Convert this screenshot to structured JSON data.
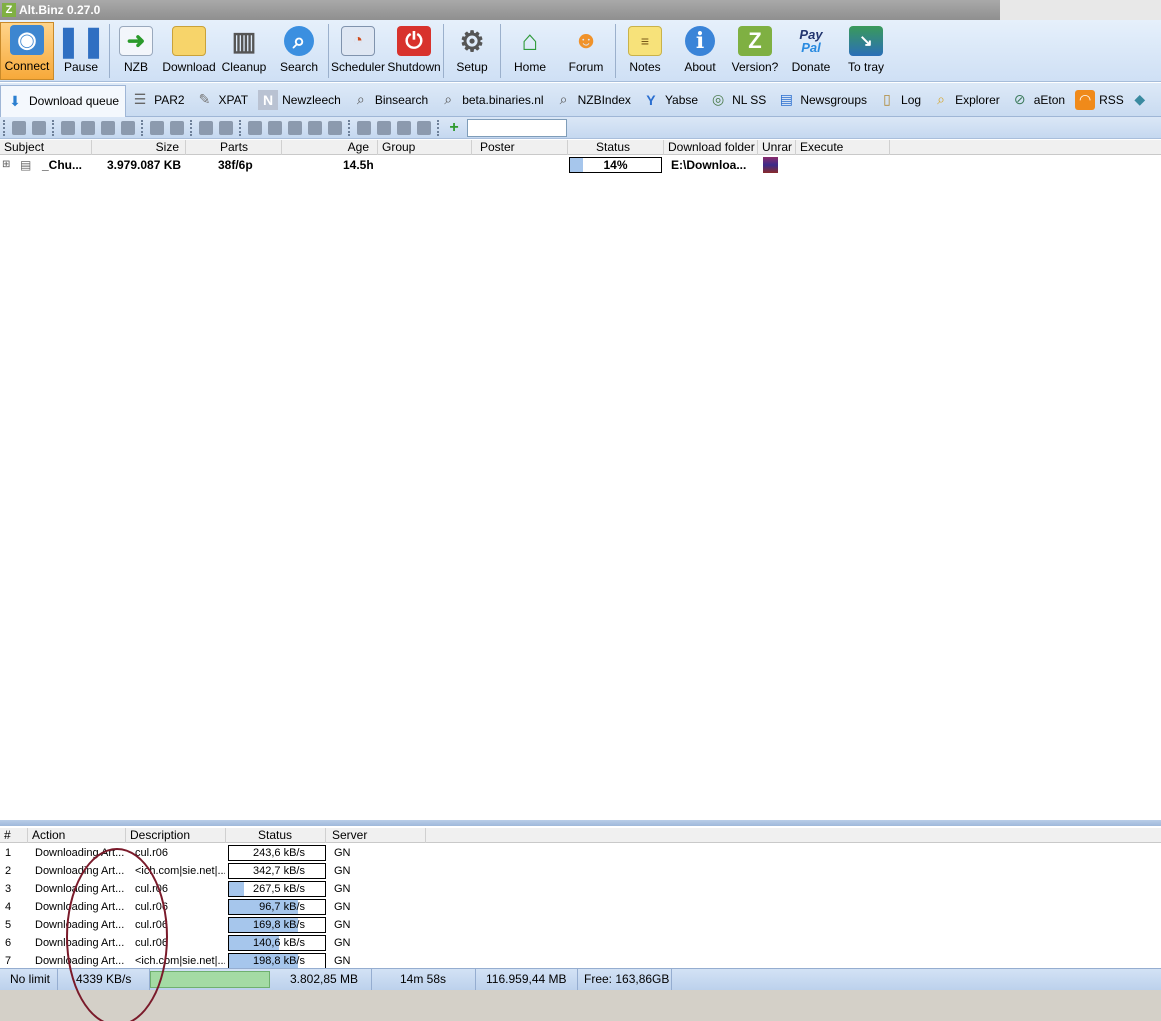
{
  "window": {
    "title": "Alt.Binz 0.27.0"
  },
  "toolbar": [
    {
      "label": "Connect",
      "icon": "connect-icon"
    },
    {
      "label": "Pause",
      "icon": "pause-icon"
    },
    {
      "label": "NZB",
      "icon": "nzb-icon"
    },
    {
      "label": "Download",
      "icon": "folder-icon"
    },
    {
      "label": "Cleanup",
      "icon": "trash-icon"
    },
    {
      "label": "Search",
      "icon": "search-icon"
    },
    {
      "label": "Scheduler",
      "icon": "calendar-clock-icon"
    },
    {
      "label": "Shutdown",
      "icon": "power-icon"
    },
    {
      "label": "Setup",
      "icon": "gear-icon"
    },
    {
      "label": "Home",
      "icon": "home-icon"
    },
    {
      "label": "Forum",
      "icon": "people-icon"
    },
    {
      "label": "Notes",
      "icon": "notes-icon"
    },
    {
      "label": "About",
      "icon": "info-icon"
    },
    {
      "label": "Version?",
      "icon": "version-icon"
    },
    {
      "label": "Donate",
      "icon": "paypal-icon"
    },
    {
      "label": "To tray",
      "icon": "tray-icon"
    }
  ],
  "donate_icon": {
    "line1": "Pay",
    "line2": "Pal"
  },
  "version_icon_letter": "Z",
  "tabs": [
    "Download queue",
    "PAR2",
    "XPAT",
    "Newzleech",
    "Binsearch",
    "beta.binaries.nl",
    "NZBIndex",
    "Yabse",
    "NL SS",
    "Newsgroups",
    "Log",
    "Explorer",
    "aEton",
    "RSS"
  ],
  "queue": {
    "columns": [
      "Subject",
      "Size",
      "Parts",
      "Age",
      "Group",
      "Poster",
      "Status",
      "Download folder",
      "Unrar",
      "Execute"
    ],
    "rows": [
      {
        "subject": "_Chu...",
        "size": "3.979.087 KB",
        "parts": "38f/6p",
        "age": "14.5h",
        "group": "",
        "poster": "",
        "status": "14%",
        "progress": 0.14,
        "folder": "E:\\Downloa..."
      }
    ]
  },
  "connections": {
    "columns": [
      "#",
      "Action",
      "Description",
      "Status",
      "Server"
    ],
    "rows": [
      {
        "num": "1",
        "action": "Downloading Art...",
        "desc": "cul.r06",
        "speed": "243,6 kB/s",
        "progress": 0.0,
        "server": "GN"
      },
      {
        "num": "2",
        "action": "Downloading Art...",
        "desc": "<ich.com|sie.net|...",
        "speed": "342,7 kB/s",
        "progress": 0.0,
        "server": "GN"
      },
      {
        "num": "3",
        "action": "Downloading Art...",
        "desc": "cul.r06",
        "speed": "267,5 kB/s",
        "progress": 0.16,
        "server": "GN"
      },
      {
        "num": "4",
        "action": "Downloading Art...",
        "desc": "cul.r06",
        "speed": "96,7 kB/s",
        "progress": 0.72,
        "server": "GN"
      },
      {
        "num": "5",
        "action": "Downloading Art...",
        "desc": "cul.r06",
        "speed": "169,8 kB/s",
        "progress": 0.72,
        "server": "GN"
      },
      {
        "num": "6",
        "action": "Downloading Art...",
        "desc": "cul.r06",
        "speed": "140,6 kB/s",
        "progress": 0.52,
        "server": "GN"
      },
      {
        "num": "7",
        "action": "Downloading Art...",
        "desc": "<ich.com|sie.net|...",
        "speed": "198,8 kB/s",
        "progress": 0.72,
        "server": "GN"
      }
    ]
  },
  "statusbar": {
    "limit": "No limit",
    "speed": "4339 KB/s",
    "remaining_size": "3.802,85 MB",
    "eta": "14m 58s",
    "total": "116.959,44 MB",
    "free": "Free: 163,86GB"
  }
}
